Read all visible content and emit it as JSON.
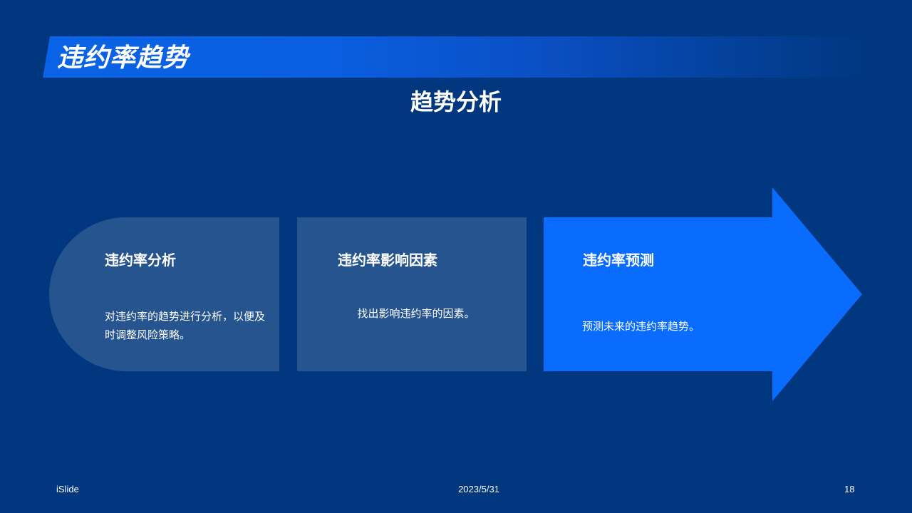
{
  "slide": {
    "title": "违约率趋势",
    "subtitle": "趋势分析"
  },
  "steps": [
    {
      "title": "违约率分析",
      "description": "对违约率的趋势进行分析，以便及时调整风险策略。"
    },
    {
      "title": "违约率影响因素",
      "description": "找出影响违约率的因素。"
    },
    {
      "title": "违约率预测",
      "description": "预测未来的违约率趋势。"
    }
  ],
  "footer": {
    "brand": "iSlide",
    "date": "2023/5/31",
    "page_number": "18"
  },
  "colors": {
    "background": "#00377f",
    "block": "#26548f",
    "accent": "#0a6cff",
    "banner": "#0a62e6",
    "text": "#ffffff"
  }
}
